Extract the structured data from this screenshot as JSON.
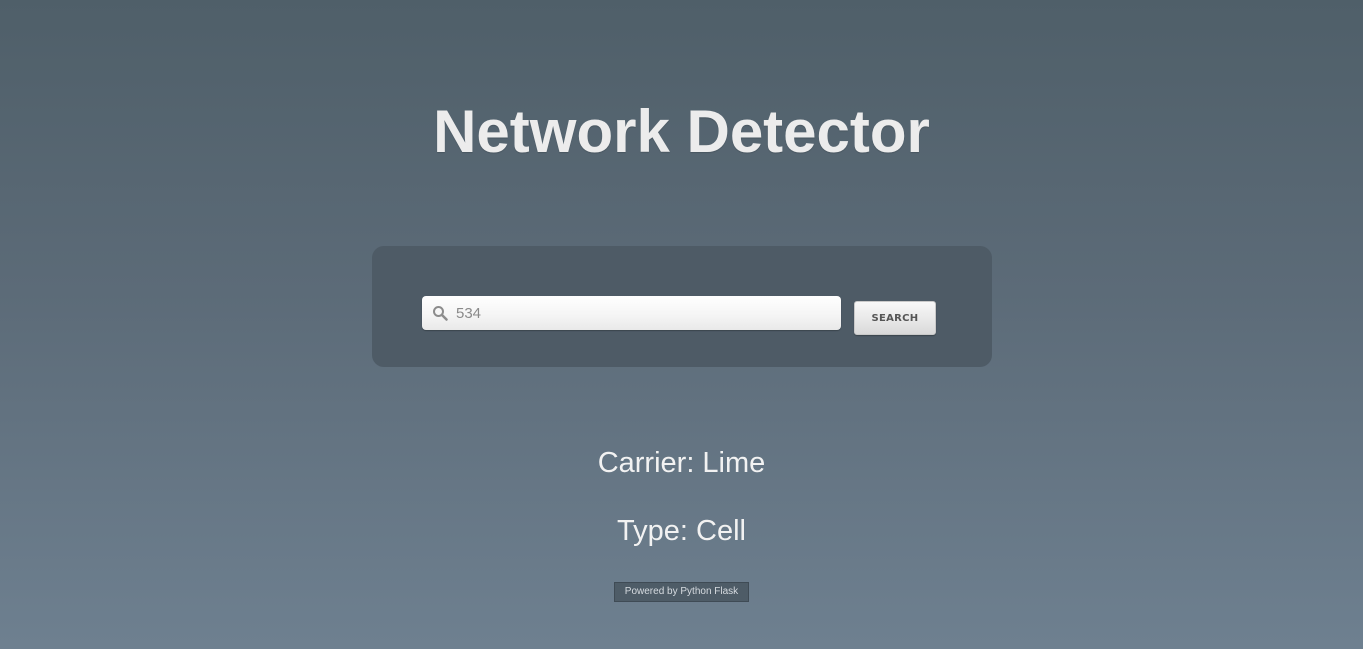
{
  "page": {
    "title": "Network Detector"
  },
  "search": {
    "value": "534",
    "placeholder": "",
    "icon": "search-icon",
    "button_label": "SEARCH"
  },
  "results": {
    "carrier": "Carrier: Lime",
    "type": "Type: Cell"
  },
  "footer": {
    "badge": "Powered by Python Flask"
  },
  "colors": {
    "background_top": "#4f5f69",
    "background_bottom": "#6e8090",
    "panel": "#4e5b66",
    "text": "#ececec"
  }
}
